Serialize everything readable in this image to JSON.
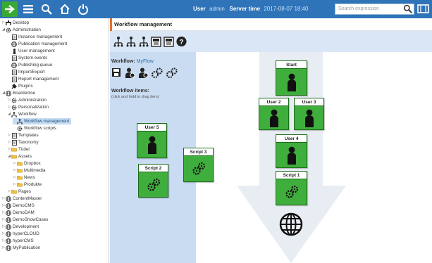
{
  "topbar": {
    "user_label": "User",
    "user_value": "admin",
    "time_label": "Server time",
    "time_value": "2017-08-07 18:40",
    "search_placeholder": "Search expression",
    "colors": {
      "bar": "#2f73b8",
      "home_btn": "#39a935"
    },
    "icons": [
      "arrow-right-icon",
      "menu-icon",
      "search-icon",
      "home-icon",
      "power-icon"
    ]
  },
  "tree": [
    {
      "label": "Desktop",
      "icon": "desk",
      "indent": 0,
      "toggle": "▷"
    },
    {
      "label": "Administration",
      "icon": "gear",
      "indent": 0,
      "toggle": "◢"
    },
    {
      "label": "Instance management",
      "icon": "doc",
      "indent": 1,
      "toggle": ""
    },
    {
      "label": "Publication management",
      "icon": "globe",
      "indent": 1,
      "toggle": ""
    },
    {
      "label": "User management",
      "icon": "person",
      "indent": 1,
      "toggle": ""
    },
    {
      "label": "System events",
      "icon": "doc",
      "indent": 1,
      "toggle": ""
    },
    {
      "label": "Publishing queue",
      "icon": "globe",
      "indent": 1,
      "toggle": ""
    },
    {
      "label": "Import/Export",
      "icon": "doc",
      "indent": 1,
      "toggle": ""
    },
    {
      "label": "Report management",
      "icon": "doc",
      "indent": 1,
      "toggle": ""
    },
    {
      "label": "Plugins",
      "icon": "plugin",
      "indent": 1,
      "toggle": ""
    },
    {
      "label": "Boarderline",
      "icon": "globe",
      "indent": 0,
      "toggle": "◢"
    },
    {
      "label": "Administration",
      "icon": "gear",
      "indent": 1,
      "toggle": "▷"
    },
    {
      "label": "Personalization",
      "icon": "gear",
      "indent": 1,
      "toggle": "▷"
    },
    {
      "label": "Workflow",
      "icon": "flow",
      "indent": 1,
      "toggle": "◢"
    },
    {
      "label": "Workflow management",
      "icon": "flow",
      "indent": 2,
      "toggle": "",
      "selected": true
    },
    {
      "label": "Workflow scripts",
      "icon": "gear",
      "indent": 2,
      "toggle": ""
    },
    {
      "label": "Templates",
      "icon": "doc",
      "indent": 1,
      "toggle": "▷"
    },
    {
      "label": "Taxonomy",
      "icon": "doc",
      "indent": 1,
      "toggle": "▷"
    },
    {
      "label": "Tüdel",
      "icon": "folder",
      "indent": 1,
      "toggle": "▷"
    },
    {
      "label": "Assets",
      "icon": "folder",
      "indent": 1,
      "toggle": "◢"
    },
    {
      "label": "Dropbox",
      "icon": "folder",
      "indent": 2,
      "toggle": "▷"
    },
    {
      "label": "Multimedia",
      "icon": "folder",
      "indent": 2,
      "toggle": "▷"
    },
    {
      "label": "News",
      "icon": "folder",
      "indent": 2,
      "toggle": "▷"
    },
    {
      "label": "Produkte",
      "icon": "folder",
      "indent": 2,
      "toggle": "▷"
    },
    {
      "label": "Pages",
      "icon": "folder",
      "indent": 1,
      "toggle": "▷"
    },
    {
      "label": "ContentMaster",
      "icon": "globe",
      "indent": 0,
      "toggle": "▷"
    },
    {
      "label": "DemoCMS",
      "icon": "globe",
      "indent": 0,
      "toggle": "▷"
    },
    {
      "label": "DemoDAM",
      "icon": "globe",
      "indent": 0,
      "toggle": "▷"
    },
    {
      "label": "DemoShowCases",
      "icon": "globe",
      "indent": 0,
      "toggle": "▷"
    },
    {
      "label": "Development",
      "icon": "globe",
      "indent": 0,
      "toggle": "▷"
    },
    {
      "label": "hyperCLOUD",
      "icon": "globe",
      "indent": 0,
      "toggle": "▷"
    },
    {
      "label": "hyperCMS",
      "icon": "globe",
      "indent": 0,
      "toggle": "▷"
    },
    {
      "label": "MyPublication",
      "icon": "globe",
      "indent": 0,
      "toggle": "▷"
    }
  ],
  "workflow": {
    "header_title": "Workflow management",
    "label": "Workflow:",
    "name": "MyFlow",
    "items_label": "Workflow items:",
    "items_hint": "(click and hold to drag item)",
    "toolbar_icons": [
      "add-workflow-icon",
      "edit-workflow-icon",
      "delete-workflow-icon",
      "import-icon",
      "export-icon",
      "help-icon"
    ],
    "panel_icons": [
      "save-icon",
      "add-user-item-icon",
      "add-user-item-2-icon",
      "add-script-item-icon",
      "add-script-item-2-icon"
    ]
  },
  "canvas_items": [
    {
      "key": "start",
      "label": "Start",
      "type": "user"
    },
    {
      "key": "user2",
      "label": "User 2",
      "type": "user"
    },
    {
      "key": "user3",
      "label": "User 3",
      "type": "user"
    },
    {
      "key": "user4",
      "label": "User 4",
      "type": "user"
    },
    {
      "key": "script1",
      "label": "Script 1",
      "type": "script"
    },
    {
      "key": "user5",
      "label": "User 5",
      "type": "user"
    },
    {
      "key": "script2",
      "label": "Script 2",
      "type": "script"
    },
    {
      "key": "script3",
      "label": "Script 3",
      "type": "script"
    }
  ],
  "colors": {
    "item_green": "#3fae3c",
    "panel_blue": "#c9dcf2",
    "toolbar_blue": "#d9e6f6",
    "accent_orange": "#e5712b",
    "arrow": "#e8edf3"
  }
}
